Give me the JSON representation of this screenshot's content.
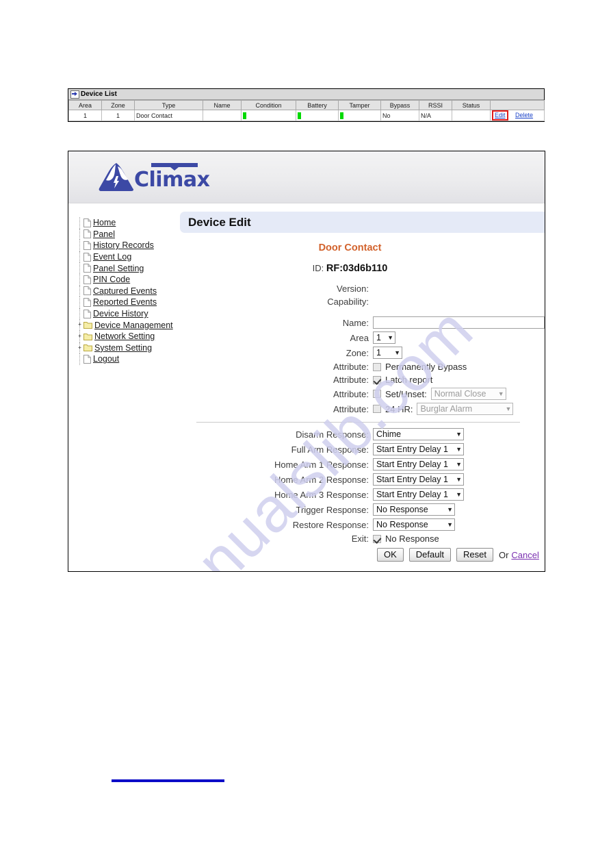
{
  "device_list": {
    "panel_title": "Device List",
    "title_icon": "arrow-right-icon",
    "columns": [
      "Area",
      "Zone",
      "Type",
      "Name",
      "Condition",
      "Battery",
      "Tamper",
      "Bypass",
      "RSSI",
      "Status",
      ""
    ],
    "rows": [
      {
        "area": "1",
        "zone": "1",
        "type": "Door Contact",
        "name": "",
        "condition": "bar-green",
        "battery": "bar-green",
        "tamper": "bar-green",
        "bypass": "No",
        "rssi": "N/A",
        "status": "",
        "edit_label": "Edit",
        "delete_label": "Delete"
      }
    ],
    "highlight_color": "#e01b1b",
    "bar_color": "#00d900",
    "link_color": "#1b42c8"
  },
  "web_ui": {
    "brand": {
      "name": "Climax",
      "logo_icon": "climax-mountain-logo",
      "color": "#3c49a5"
    },
    "sidebar": {
      "items": [
        {
          "label": "Home",
          "icon": "file-icon",
          "expandable": false
        },
        {
          "label": "Panel",
          "icon": "file-icon",
          "expandable": false
        },
        {
          "label": "History Records",
          "icon": "file-icon",
          "expandable": false
        },
        {
          "label": "Event Log",
          "icon": "file-icon",
          "expandable": false
        },
        {
          "label": "Panel Setting",
          "icon": "file-icon",
          "expandable": false
        },
        {
          "label": "PIN Code",
          "icon": "file-icon",
          "expandable": false
        },
        {
          "label": "Captured Events",
          "icon": "file-icon",
          "expandable": false
        },
        {
          "label": "Reported Events",
          "icon": "file-icon",
          "expandable": false
        },
        {
          "label": "Device History",
          "icon": "file-icon",
          "expandable": false
        },
        {
          "label": "Device Management",
          "icon": "folder-icon",
          "expandable": true,
          "expander": "+"
        },
        {
          "label": "Network Setting",
          "icon": "folder-icon",
          "expandable": true,
          "expander": "+"
        },
        {
          "label": "System Setting",
          "icon": "folder-icon",
          "expandable": true,
          "expander": "+"
        },
        {
          "label": "Logout",
          "icon": "file-icon",
          "expandable": false
        }
      ]
    },
    "content": {
      "title": "Device Edit",
      "device_type": "Door Contact",
      "id_label": "ID:",
      "id_value": "RF:03d6b110",
      "version_label": "Version:",
      "version_value": "",
      "capability_label": "Capability:",
      "capability_value": "",
      "name_label": "Name:",
      "name_value": "",
      "area_label": "Area",
      "area_value": "1",
      "zone_label": "Zone:",
      "zone_value": "1",
      "attributes": [
        {
          "label": "Attribute:",
          "text": "Permanently Bypass",
          "checked": false,
          "has_select": false
        },
        {
          "label": "Attribute:",
          "text": "Latch report",
          "checked": true,
          "has_select": false
        },
        {
          "label": "Attribute:",
          "text": "Set/Unset:",
          "checked": false,
          "has_select": true,
          "select_value": "Normal Close",
          "select_disabled": true
        },
        {
          "label": "Attribute:",
          "text": "24 HR:",
          "checked": false,
          "has_select": true,
          "select_value": "Burglar Alarm",
          "select_disabled": true
        }
      ],
      "responses": [
        {
          "label": "Disarm Response:",
          "value": "Chime"
        },
        {
          "label": "Full Arm Response:",
          "value": "Start Entry Delay 1"
        },
        {
          "label": "Home Arm 1 Response:",
          "value": "Start Entry Delay 1"
        },
        {
          "label": "Home Arm 2 Response:",
          "value": "Start Entry Delay 1"
        },
        {
          "label": "Home Arm 3 Response:",
          "value": "Start Entry Delay 1"
        },
        {
          "label": "Trigger Response:",
          "value": "No Response"
        },
        {
          "label": "Restore Response:",
          "value": "No Response"
        }
      ],
      "exit_label": "Exit:",
      "exit_text": "No Response",
      "exit_checked": true,
      "buttons": {
        "ok": "OK",
        "default": "Default",
        "reset": "Reset",
        "or": "Or",
        "cancel": "Cancel"
      },
      "title_bg": "#e5eaf7",
      "device_type_color": "#d2622c"
    }
  },
  "watermark": {
    "text": "manualslib.com"
  }
}
